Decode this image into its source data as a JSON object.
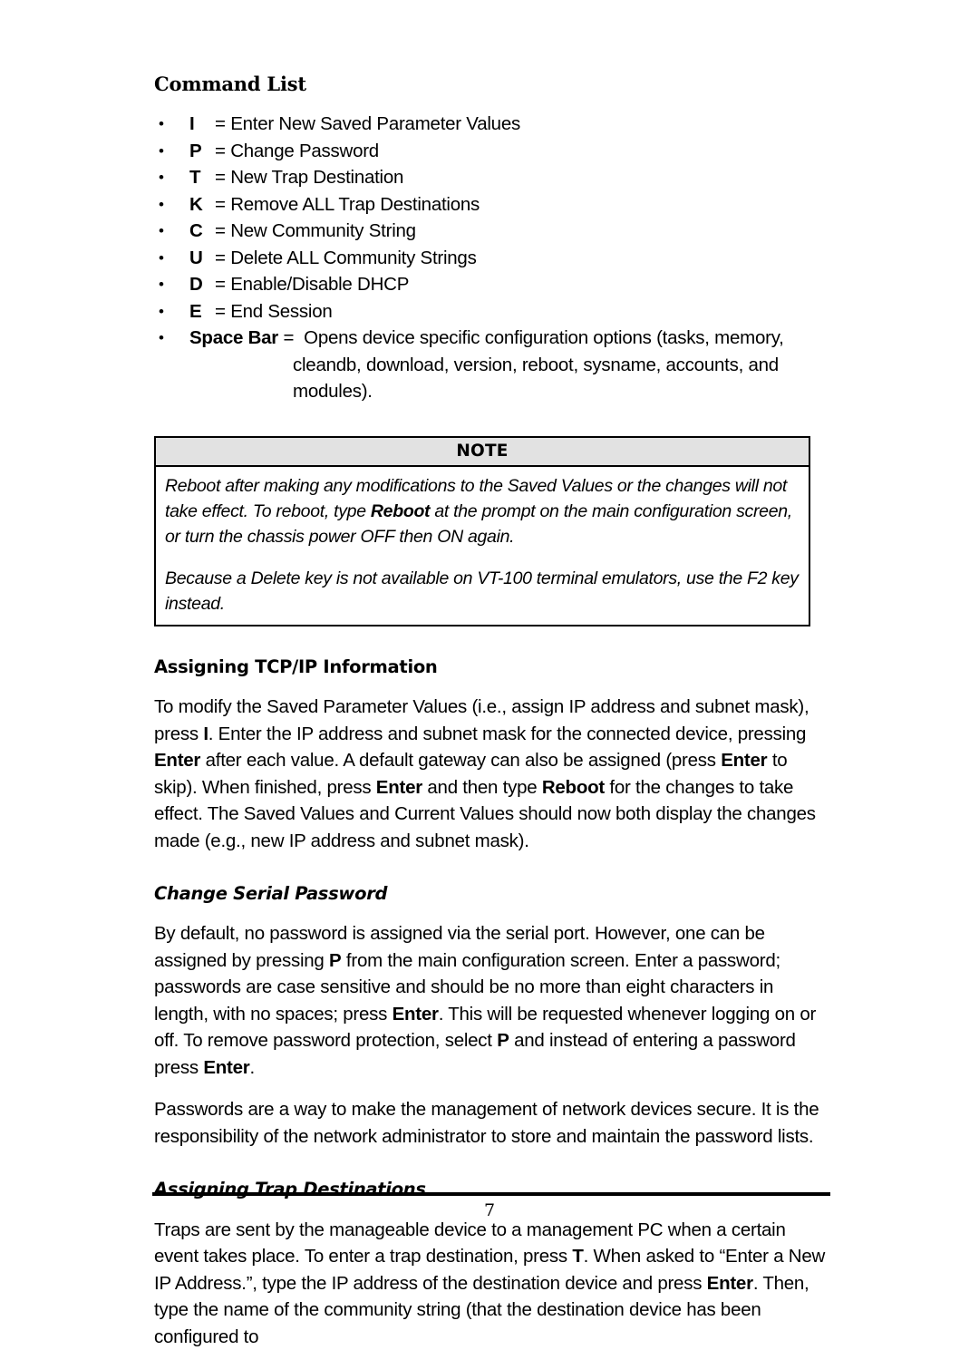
{
  "document": {
    "section_title": "Command List",
    "page_number": "7"
  },
  "command_list": {
    "bullet_glyph": "•",
    "equals": "=",
    "items": [
      {
        "key": "I",
        "desc": "Enter New Saved Parameter Values"
      },
      {
        "key": "P",
        "desc": "Change Password"
      },
      {
        "key": "T",
        "desc": "New Trap Destination"
      },
      {
        "key": "K",
        "desc": "Remove ALL Trap Destinations"
      },
      {
        "key": "C",
        "desc": "New Community String"
      },
      {
        "key": "U",
        "desc": "Delete ALL Community Strings"
      },
      {
        "key": "D",
        "desc": "Enable/Disable DHCP"
      },
      {
        "key": "E",
        "desc": "End Session"
      }
    ],
    "space_bar": {
      "key": "Space Bar",
      "line1": "Opens device specific configuration options (tasks, memory,",
      "line2": "cleandb, download, version, reboot, sysname, accounts, and",
      "line3": "modules)."
    }
  },
  "note_box": {
    "header": "NOTE",
    "paragraph1_part1": "Reboot after making any modifications to the Saved Values or the changes will not take effect.  To reboot, type ",
    "paragraph1_bold": "Reboot",
    "paragraph1_part2": " at the prompt on the main configuration screen, or turn the chassis power OFF then ON again.",
    "paragraph2": "Because a Delete key is not available on VT-100 terminal emulators, use the F2 key instead."
  },
  "tcpip_section": {
    "heading": "Assigning TCP/IP Information",
    "p1_a": "To modify the Saved Parameter Values (i.e., assign IP address and subnet mask), press ",
    "p1_b1": "I",
    "p1_b": ".  Enter the IP address and subnet mask for the connected device, pressing ",
    "p1_b2": "Enter",
    "p1_c": " after each value.  A default gateway can also be assigned (press ",
    "p1_b3": "Enter",
    "p1_d": " to skip).  When finished, press ",
    "p1_b4": "Enter",
    "p1_e": " and then type ",
    "p1_b5": "Reboot",
    "p1_f": " for the changes to take effect.  The Saved Values and Current Values should now both display the changes made (e.g., new IP address and subnet mask)."
  },
  "password_section": {
    "heading": "Change Serial Password",
    "p1_a": "By default, no password is assigned via the serial port.  However, one can be assigned by pressing ",
    "p1_b1": "P",
    "p1_b": " from the main configuration screen.  Enter a password; passwords are case sensitive and should be no more than eight characters in length, with no spaces; press ",
    "p1_b2": "Enter",
    "p1_c": ".  This will be requested whenever logging on or off.  To remove password protection, select ",
    "p1_b3": "P",
    "p1_d": " and instead of entering a password press ",
    "p1_b4": "Enter",
    "p1_e": ".",
    "p2": "Passwords are a way to make the management of network devices secure.  It is the responsibility of the network administrator to store and maintain the password lists."
  },
  "traps_section": {
    "heading": "Assigning Trap Destinations",
    "p1_a": "Traps are sent by the manageable device to a management PC when a certain event takes place.  To enter a trap destination, press ",
    "p1_b1": "T",
    "p1_b": ".  When asked to “Enter a New IP Address.”, type the IP address of the destination device and press ",
    "p1_b2": "Enter",
    "p1_c": ".  Then, type the name of the community string (that the destination device has been configured to"
  }
}
